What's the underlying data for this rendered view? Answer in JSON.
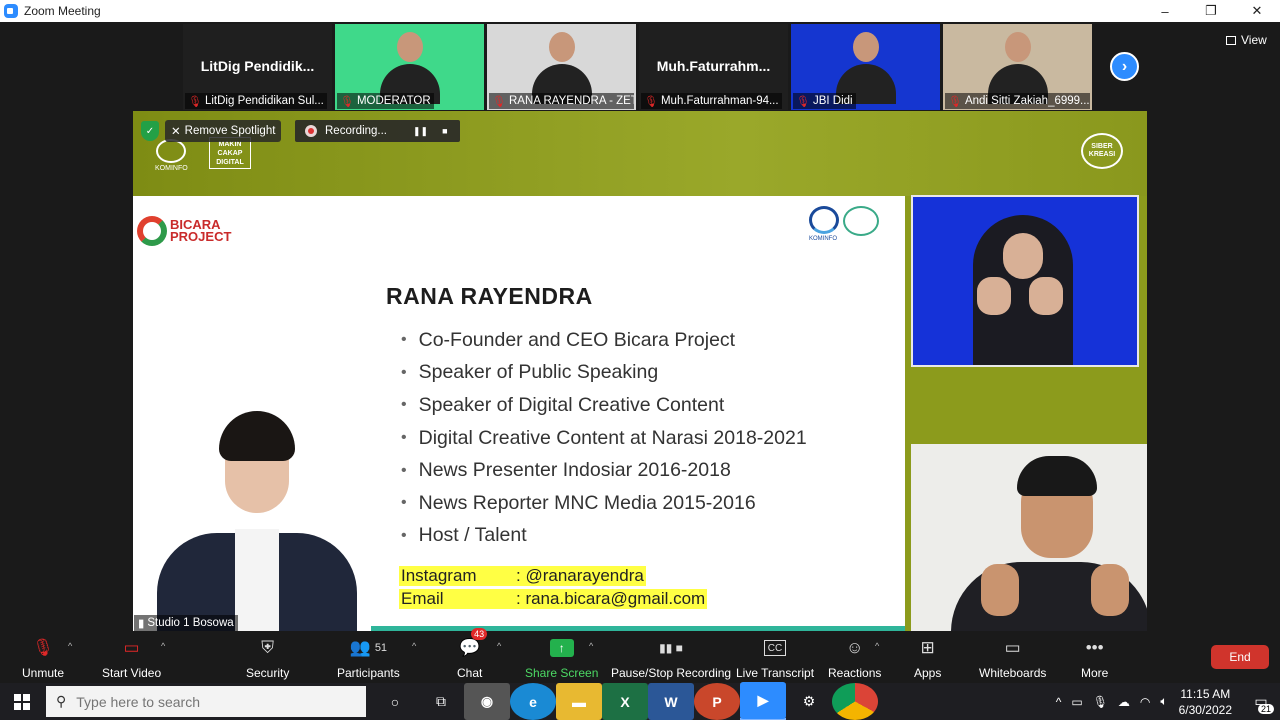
{
  "window": {
    "title": "Zoom Meeting",
    "minimize": "–",
    "restore": "❐",
    "close": "✕"
  },
  "view_button": "View",
  "participants_strip": [
    {
      "big_name": "LitDig  Pendidik...",
      "label": "LitDig Pendidikan Sul...",
      "video": false
    },
    {
      "big_name": "",
      "label": "MODERATOR",
      "video": true,
      "bg": "#3fd98a"
    },
    {
      "big_name": "",
      "label": "RANA RAYENDRA - ZETT...",
      "video": true,
      "bg": "#d8d8d8"
    },
    {
      "big_name": "Muh.Faturrahm...",
      "label": "Muh.Faturrahman-94...",
      "video": false
    },
    {
      "big_name": "",
      "label": "JBI Didi",
      "video": true,
      "bg": "#1536d0"
    },
    {
      "big_name": "",
      "label": "Andi Sitti Zakiah_6999...",
      "video": true,
      "bg": "#c9b9a0"
    }
  ],
  "next_arrow": "›",
  "spotlight": {
    "shield": "✓",
    "remove_label": "Remove Spotlight",
    "recording_label": "Recording...",
    "pause": "❚❚",
    "stop": "■"
  },
  "share": {
    "kominfo_caption": "KOMINFO",
    "makin_cakap": "MAKIN CAKAP DIGITAL",
    "siber_kreasi": "SIBER KREASI",
    "slide": {
      "logo_text": "BICARA PROJECT",
      "kominfo_caption": "KOMINFO",
      "name": "RANA RAYENDRA",
      "bullets": [
        "Co-Founder and CEO Bicara Project",
        "Speaker of Public Speaking",
        "Speaker of Digital Creative Content",
        "Digital Creative Content at Narasi 2018-2021",
        "News Presenter Indosiar 2016-2018",
        "News Reporter MNC Media 2015-2016",
        "Host / Talent"
      ],
      "contact": [
        {
          "key": "Instagram",
          "value": ": @ranarayendra"
        },
        {
          "key": "Email",
          "value": ": rana.bicara@gmail.com"
        }
      ]
    },
    "studio_label": "Studio 1 Bosowa"
  },
  "toolbar": {
    "unmute": "Unmute",
    "start_video": "Start Video",
    "security": "Security",
    "participants": "Participants",
    "participants_count": "51",
    "chat": "Chat",
    "chat_badge": "43",
    "share_screen": "Share Screen",
    "pause_stop": "Pause/Stop Recording",
    "live_transcript": "Live Transcript",
    "cc": "CC",
    "reactions": "Reactions",
    "apps": "Apps",
    "whiteboards": "Whiteboards",
    "more": "More",
    "end": "End"
  },
  "taskbar": {
    "search_placeholder": "Type here to search",
    "time": "11:15 AM",
    "date": "6/30/2022",
    "notif_count": "21"
  }
}
